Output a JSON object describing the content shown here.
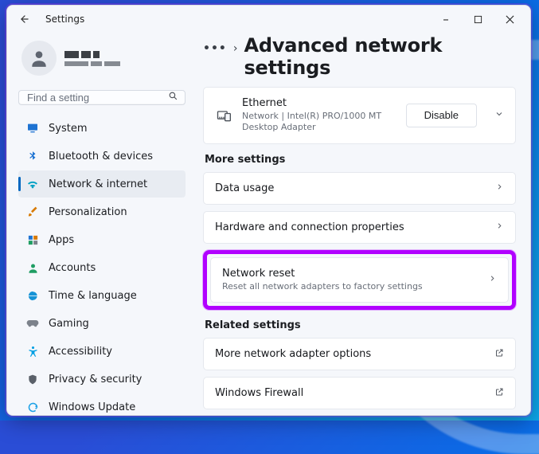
{
  "app_title": "Settings",
  "breadcrumb_sep": "›",
  "page_title": "Advanced network settings",
  "search": {
    "placeholder": "Find a setting"
  },
  "nav": {
    "items": [
      {
        "label": "System"
      },
      {
        "label": "Bluetooth & devices"
      },
      {
        "label": "Network & internet"
      },
      {
        "label": "Personalization"
      },
      {
        "label": "Apps"
      },
      {
        "label": "Accounts"
      },
      {
        "label": "Time & language"
      },
      {
        "label": "Gaming"
      },
      {
        "label": "Accessibility"
      },
      {
        "label": "Privacy & security"
      },
      {
        "label": "Windows Update"
      }
    ]
  },
  "adapter": {
    "name": "Ethernet",
    "desc": "Network | Intel(R) PRO/1000 MT Desktop Adapter",
    "action": "Disable"
  },
  "sections": {
    "more": "More settings",
    "related": "Related settings"
  },
  "rows": {
    "data_usage": "Data usage",
    "hw_props": "Hardware and connection properties",
    "net_reset_title": "Network reset",
    "net_reset_sub": "Reset all network adapters to factory settings",
    "more_adapter": "More network adapter options",
    "firewall": "Windows Firewall"
  }
}
